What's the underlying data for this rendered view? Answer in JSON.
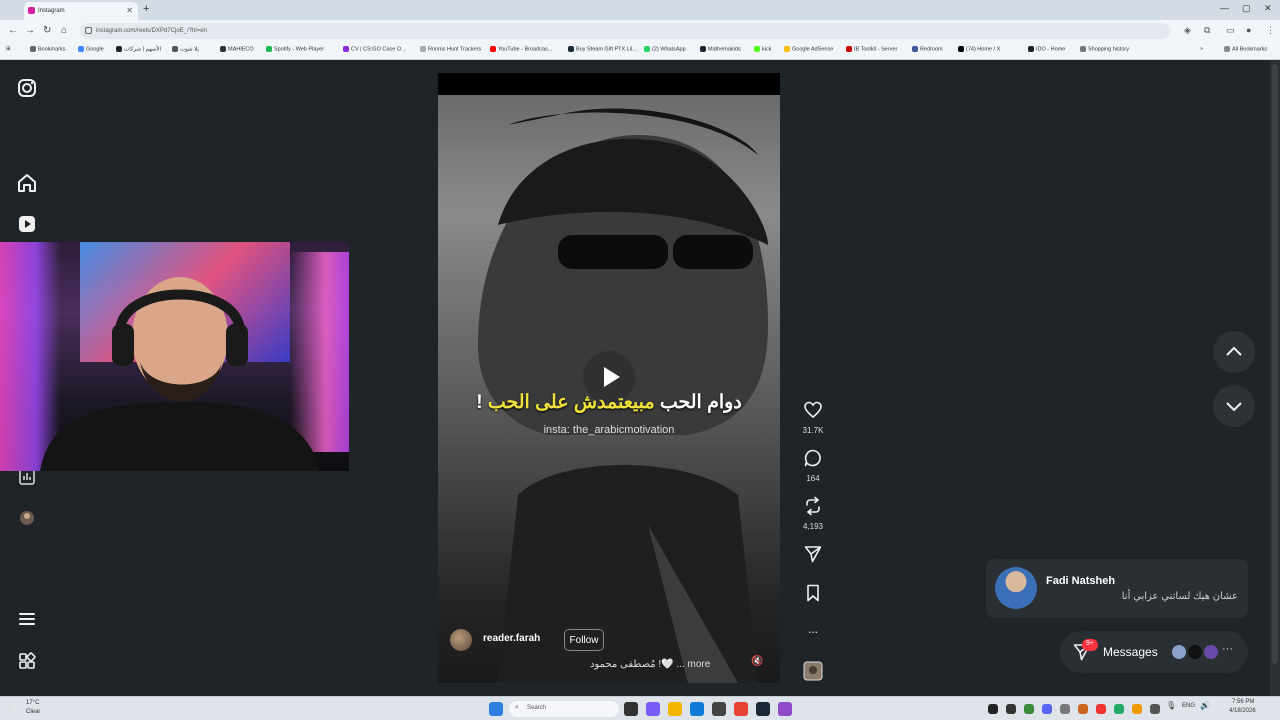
{
  "browser": {
    "tab_title": "Instagram",
    "url": "instagram.com/reels/DXPd7CjoE_/?hl=en",
    "bookmarks": [
      "Bookmarks",
      "Google",
      "الأسهم | شركات",
      "يلا شوت",
      "MAHIECO",
      "Spotify - Web Player",
      "CV | CS:GO Case O...",
      "Rooms Hunt Trackers",
      "YouTube - Broadcas...",
      "Buy Steam Gift PTX Lil...",
      "(2) WhatsApp",
      "Mathemakids",
      "kick",
      "Google AdSense",
      "IB Toolkit - Server",
      "Redroom",
      "(74) Home / X",
      "IDO - Home",
      "Shopping history"
    ],
    "all_bookmarks": "All Bookmarks",
    "colors": {
      "chrome": "#dde3ea",
      "accent": "#d6249f"
    }
  },
  "sidebar": {
    "icons": [
      "instagram-icon",
      "home-icon",
      "reels-icon",
      "insights-icon",
      "profile-avatar",
      "menu-icon",
      "more-apps-icon"
    ]
  },
  "reel": {
    "caption_white": "دوام الحب ",
    "caption_yellow": "مبيعتمدش على الحب",
    "caption_end": " !",
    "watermark": "insta: the_arabicmotivation",
    "author": "reader.farah",
    "follow": "Follow",
    "description": "مُصطفى محمود !🤍 ... more",
    "mute_icon": "🔇"
  },
  "actions": {
    "likes": "31.7K",
    "comments": "164",
    "reposts": "4,193",
    "share_icon": "share-icon",
    "save_icon": "bookmark-icon",
    "more": "..."
  },
  "toast": {
    "name": "Fadi Natsheh",
    "message": "عشان هيك لساتني عزابي أنا"
  },
  "messages": {
    "label": "Messages",
    "badge": "9+"
  },
  "taskbar": {
    "weather": "17°C",
    "weather_sub": "Clear",
    "search": "Search",
    "lang": "ENG",
    "time": "7:56 PM",
    "date": "4/18/2026"
  }
}
